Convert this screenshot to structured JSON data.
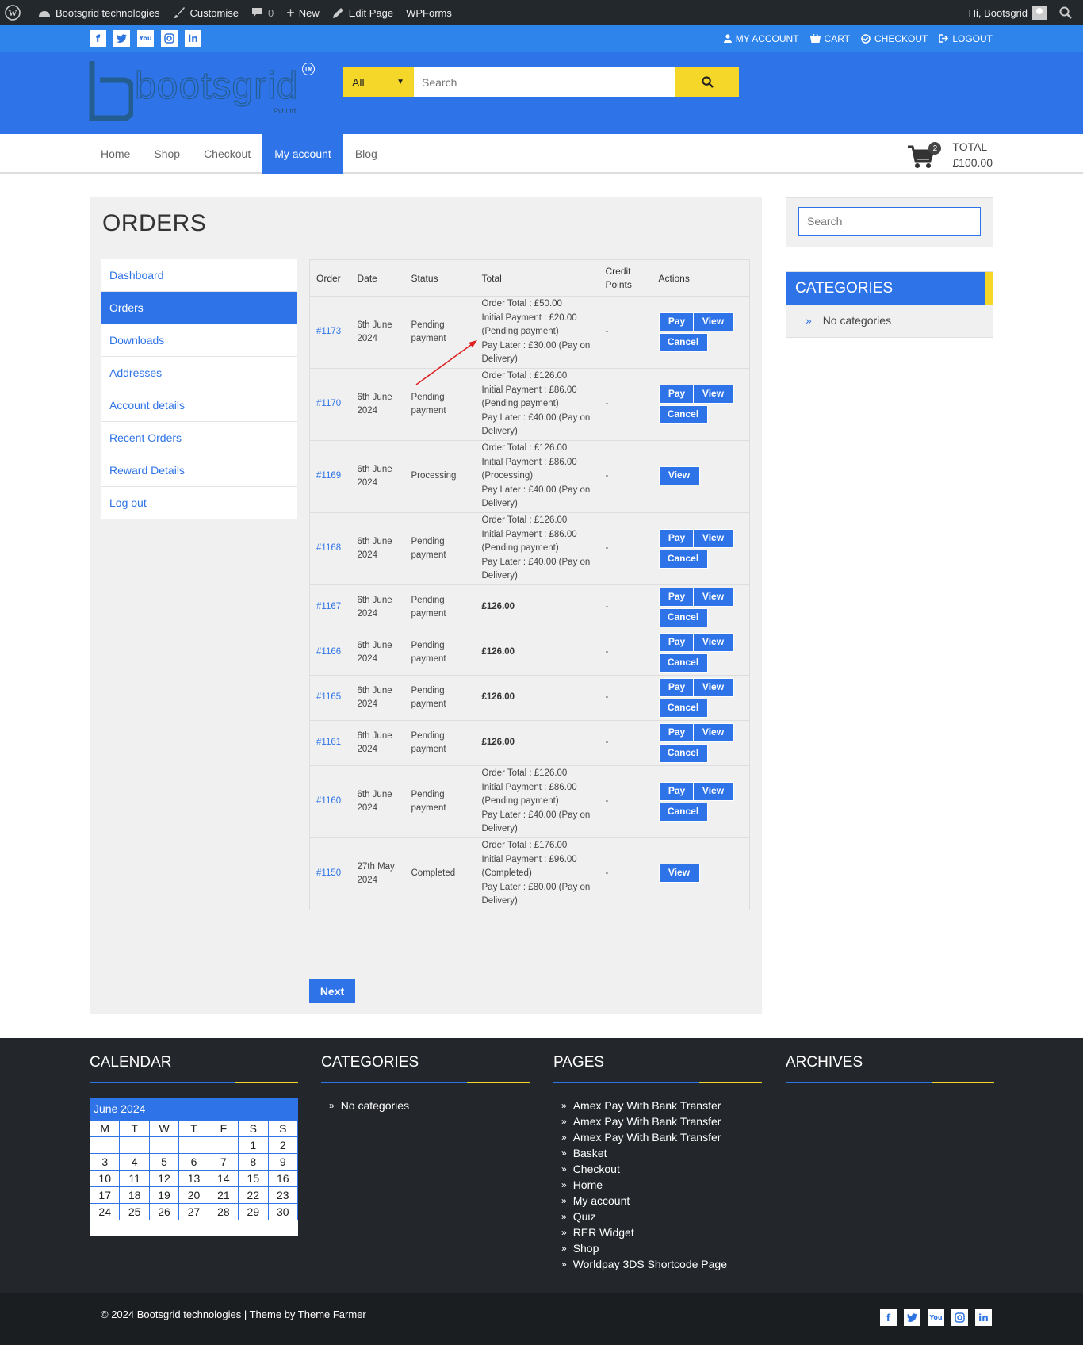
{
  "adminbar": {
    "site_name": "Bootsgrid technologies",
    "customise": "Customise",
    "comments": "0",
    "new": "New",
    "edit_page": "Edit Page",
    "wpforms": "WPForms",
    "greeting": "Hi, Bootsgrid"
  },
  "topbar": {
    "social": [
      "f",
      "t",
      "yt",
      "ig",
      "in"
    ],
    "links": [
      "MY ACCOUNT",
      "CART",
      "CHECKOUT",
      "LOGOUT"
    ]
  },
  "header": {
    "logo_text": "bootsgrid",
    "logo_sub": "Pvt Ltd",
    "logo_tm": "TM",
    "search_category": "All",
    "search_placeholder": "Search"
  },
  "nav": {
    "items": [
      "Home",
      "Shop",
      "Checkout",
      "My account",
      "Blog"
    ],
    "active": "My account",
    "cart_count": "2",
    "total_label": "TOTAL",
    "total_value": "£100.00"
  },
  "page": {
    "title": "ORDERS",
    "account_nav": [
      "Dashboard",
      "Orders",
      "Downloads",
      "Addresses",
      "Account details",
      "Recent Orders",
      "Reward Details",
      "Log out"
    ],
    "headers": {
      "order": "Order",
      "date": "Date",
      "status": "Status",
      "total": "Total",
      "credit": "Credit Points",
      "actions": "Actions"
    },
    "buttons": {
      "pay": "Pay",
      "view": "View",
      "cancel": "Cancel",
      "next": "Next"
    },
    "orders": [
      {
        "num": "#1173",
        "date": "6th June 2024",
        "status": "Pending payment",
        "total_lines": [
          "Order Total : £50.00",
          "Initial Payment : £20.00",
          "(Pending payment)",
          "Pay Later : £30.00 (Pay on Delivery)"
        ],
        "credit": "-",
        "actions": "pay-view-cancel"
      },
      {
        "num": "#1170",
        "date": "6th June 2024",
        "status": "Pending payment",
        "total_lines": [
          "Order Total : £126.00",
          "Initial Payment : £86.00",
          "(Pending payment)",
          "Pay Later : £40.00 (Pay on Delivery)"
        ],
        "credit": "-",
        "actions": "pay-view-cancel"
      },
      {
        "num": "#1169",
        "date": "6th June 2024",
        "status": "Processing",
        "total_lines": [
          "Order Total : £126.00",
          "Initial Payment : £86.00",
          "(Processing)",
          "Pay Later : £40.00 (Pay on Delivery)"
        ],
        "credit": "-",
        "actions": "view"
      },
      {
        "num": "#1168",
        "date": "6th June 2024",
        "status": "Pending payment",
        "total_lines": [
          "Order Total : £126.00",
          "Initial Payment : £86.00",
          "(Pending payment)",
          "Pay Later : £40.00 (Pay on Delivery)"
        ],
        "credit": "-",
        "actions": "pay-view-cancel"
      },
      {
        "num": "#1167",
        "date": "6th June 2024",
        "status": "Pending payment",
        "total_bold": "£126.00",
        "credit": "-",
        "actions": "pay-view-cancel"
      },
      {
        "num": "#1166",
        "date": "6th June 2024",
        "status": "Pending payment",
        "total_bold": "£126.00",
        "credit": "-",
        "actions": "pay-view-cancel"
      },
      {
        "num": "#1165",
        "date": "6th June 2024",
        "status": "Pending payment",
        "total_bold": "£126.00",
        "credit": "-",
        "actions": "pay-view-cancel"
      },
      {
        "num": "#1161",
        "date": "6th June 2024",
        "status": "Pending payment",
        "total_bold": "£126.00",
        "credit": "-",
        "actions": "pay-view-cancel"
      },
      {
        "num": "#1160",
        "date": "6th June 2024",
        "status": "Pending payment",
        "total_lines": [
          "Order Total : £126.00",
          "Initial Payment : £86.00",
          "(Pending payment)",
          "Pay Later : £40.00 (Pay on Delivery)"
        ],
        "credit": "-",
        "actions": "pay-view-cancel"
      },
      {
        "num": "#1150",
        "date": "27th May 2024",
        "status": "Completed",
        "total_lines": [
          "Order Total : £176.00",
          "Initial Payment : £96.00",
          "(Completed)",
          "Pay Later : £80.00 (Pay on Delivery)"
        ],
        "credit": "-",
        "actions": "view"
      }
    ]
  },
  "sidebar": {
    "search_placeholder": "Search",
    "categories_title": "CATEGORIES",
    "categories_empty": "No categories"
  },
  "footer": {
    "calendar_title": "CALENDAR",
    "calendar_month": "June 2024",
    "weekdays": [
      "M",
      "T",
      "W",
      "T",
      "F",
      "S",
      "S"
    ],
    "weeks": [
      [
        "",
        "",
        "",
        "",
        "",
        "1",
        "2"
      ],
      [
        "3",
        "4",
        "5",
        "6",
        "7",
        "8",
        "9"
      ],
      [
        "10",
        "11",
        "12",
        "13",
        "14",
        "15",
        "16"
      ],
      [
        "17",
        "18",
        "19",
        "20",
        "21",
        "22",
        "23"
      ],
      [
        "24",
        "25",
        "26",
        "27",
        "28",
        "29",
        "30"
      ]
    ],
    "categories_title": "CATEGORIES",
    "categories_empty": "No categories",
    "pages_title": "PAGES",
    "pages": [
      "Amex Pay With Bank Transfer",
      "Amex Pay With Bank Transfer",
      "Amex Pay With Bank Transfer",
      "Basket",
      "Checkout",
      "Home",
      "My account",
      "Quiz",
      "RER Widget",
      "Shop",
      "Worldpay 3DS Shortcode Page"
    ],
    "archives_title": "ARCHIVES",
    "copyright": "© 2024 Bootsgrid technologies | Theme by Theme Farmer",
    "social": [
      "f",
      "t",
      "yt",
      "ig",
      "in"
    ]
  },
  "colors": {
    "brand_blue": "#2e74e8",
    "accent_yellow": "#f5d72a",
    "admin_dark": "#23282d",
    "footer_dark": "#23272b"
  }
}
